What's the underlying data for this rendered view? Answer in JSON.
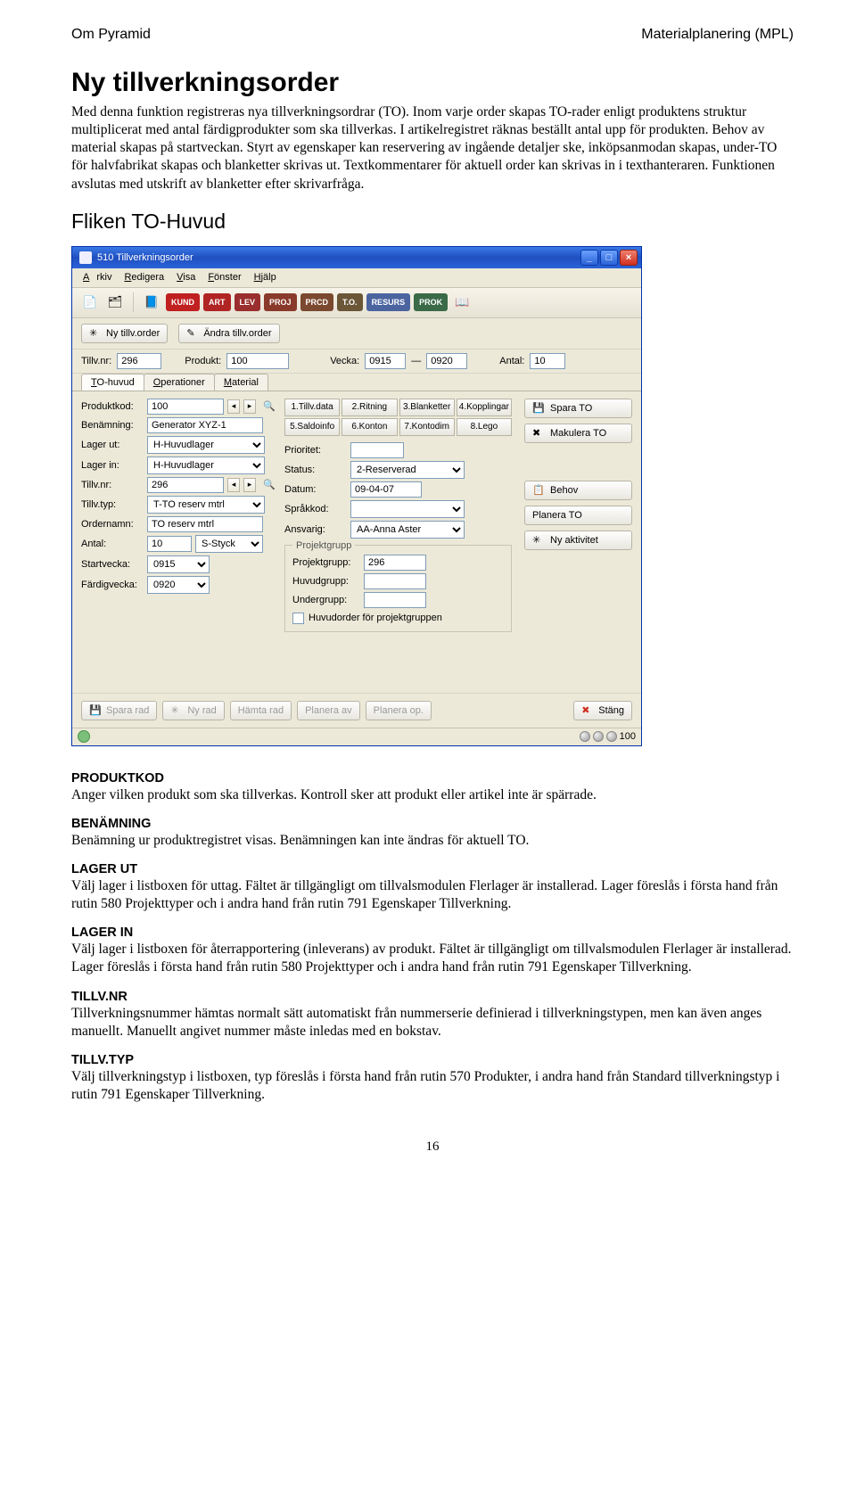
{
  "header": {
    "left": "Om Pyramid",
    "right": "Materialplanering (MPL)"
  },
  "title": "Ny tillverkningsorder",
  "intro": "Med denna funktion registreras nya tillverkningsordrar (TO). Inom varje order skapas TO-rader enligt produktens struktur multiplicerat med antal färdigprodukter som ska tillverkas. I artikelregistret räknas beställt antal upp för produkten. Behov av material skapas på startveckan. Styrt av egenskaper kan reservering av ingående detaljer ske, inköpsanmodan skapas, under-TO för halvfabrikat skapas och blanketter skrivas ut. Textkommentarer för aktuell order kan skrivas in i texthanteraren. Funktionen avslutas med utskrift av blanketter efter skrivarfråga.",
  "flik": "Fliken TO-Huvud",
  "window": {
    "title": "510 Tillverkningsorder",
    "menus": {
      "m1": "Arkiv",
      "m2": "Redigera",
      "m3": "Visa",
      "m4": "Fönster",
      "m5": "Hjälp"
    },
    "pills": {
      "p1": "KUND",
      "p2": "ART",
      "p3": "LEV",
      "p4": "PROJ",
      "p5": "PRCD",
      "p6": "T.O.",
      "p7": "RESURS",
      "p8": "PROK"
    },
    "topbuttons": {
      "b1": "Ny tillv.order",
      "b2": "Ändra tillv.order"
    },
    "summary": {
      "l1": "Tillv.nr:",
      "v1": "296",
      "l2": "Produkt:",
      "v2": "100",
      "l3": "Vecka:",
      "v3": "0915",
      "v3b": "0920",
      "l4": "Antal:",
      "v4": "10"
    },
    "tabs": {
      "t1": "TO-huvud",
      "t2": "Operationer",
      "t3": "Material"
    },
    "left": {
      "produktkod_l": "Produktkod:",
      "produktkod": "100",
      "benamning_l": "Benämning:",
      "benamning": "Generator XYZ-1",
      "lagerut_l": "Lager ut:",
      "lagerut": "H-Huvudlager",
      "lagerin_l": "Lager in:",
      "lagerin": "H-Huvudlager",
      "tillvnr_l": "Tillv.nr:",
      "tillvnr": "296",
      "tillvtyp_l": "Tillv.typ:",
      "tillvtyp": "T-TO reserv mtrl",
      "ordernamn_l": "Ordernamn:",
      "ordernamn": "TO reserv mtrl",
      "antal_l": "Antal:",
      "antal": "10",
      "antal_enh": "S-Styck",
      "startvecka_l": "Startvecka:",
      "startvecka": "0915",
      "fardigvecka_l": "Färdigvecka:",
      "fardigvecka": "0920"
    },
    "numbtns": {
      "n1": "1.Tillv.data",
      "n2": "2.Ritning",
      "n3": "3.Blanketter",
      "n4": "4.Kopplingar",
      "n5": "5.Saldoinfo",
      "n6": "6.Konton",
      "n7": "7.Kontodim",
      "n8": "8.Lego"
    },
    "mid": {
      "prioritet_l": "Prioritet:",
      "prioritet": "",
      "status_l": "Status:",
      "status": "2-Reserverad",
      "datum_l": "Datum:",
      "datum": "09-04-07",
      "sprakkod_l": "Språkkod:",
      "sprakkod": "",
      "ansvarig_l": "Ansvarig:",
      "ansvarig": "AA-Anna Aster",
      "grouptitle": "Projektgrupp",
      "projektgrupp_l": "Projektgrupp:",
      "projektgrupp": "296",
      "huvudgrupp_l": "Huvudgrupp:",
      "huvudgrupp": "",
      "undergrupp_l": "Undergrupp:",
      "undergrupp": "",
      "chk": "Huvudorder för projektgruppen"
    },
    "right": {
      "spara": "Spara TO",
      "makulera": "Makulera TO",
      "behov": "Behov",
      "planera": "Planera TO",
      "nyakt": "Ny aktivitet"
    },
    "bottom": {
      "b1": "Spara rad",
      "b2": "Ny rad",
      "b3": "Hämta rad",
      "b4": "Planera av",
      "b5": "Planera op.",
      "stang": "Stäng",
      "pct": "100"
    }
  },
  "sections": {
    "produktkod_h": "PRODUKTKOD",
    "produktkod": "Anger vilken produkt som ska tillverkas. Kontroll sker att produkt eller artikel inte är spärrade.",
    "benamning_h": "BENÄMNING",
    "benamning": "Benämning ur produktregistret visas. Benämningen kan inte ändras för aktuell TO.",
    "lagerut_h": "LAGER UT",
    "lagerut": "Välj lager i listboxen för uttag. Fältet är tillgängligt om tillvalsmodulen Flerlager är installerad. Lager föreslås i första hand från rutin 580 Projekttyper och i andra hand från rutin 791 Egenskaper Tillverkning.",
    "lagerin_h": "LAGER IN",
    "lagerin": "Välj lager i listboxen för återrapportering (inleverans) av produkt. Fältet är tillgängligt om tillvalsmodulen Flerlager är installerad. Lager föreslås i första hand från rutin 580 Projekttyper och i andra hand från rutin 791 Egenskaper Tillverkning.",
    "tillvnr_h": "TILLV.NR",
    "tillvnr": "Tillverkningsnummer hämtas normalt sätt automatiskt från nummerserie definierad i tillverkningstypen, men kan även anges manuellt. Manuellt angivet nummer måste inledas med en bokstav.",
    "tillvtyp_h": "TILLV.TYP",
    "tillvtyp": "Välj tillverkningstyp i listboxen, typ föreslås i första hand från rutin 570 Produkter, i andra hand från Standard tillverkningstyp i rutin 791 Egenskaper Tillverkning."
  },
  "footer": "16"
}
